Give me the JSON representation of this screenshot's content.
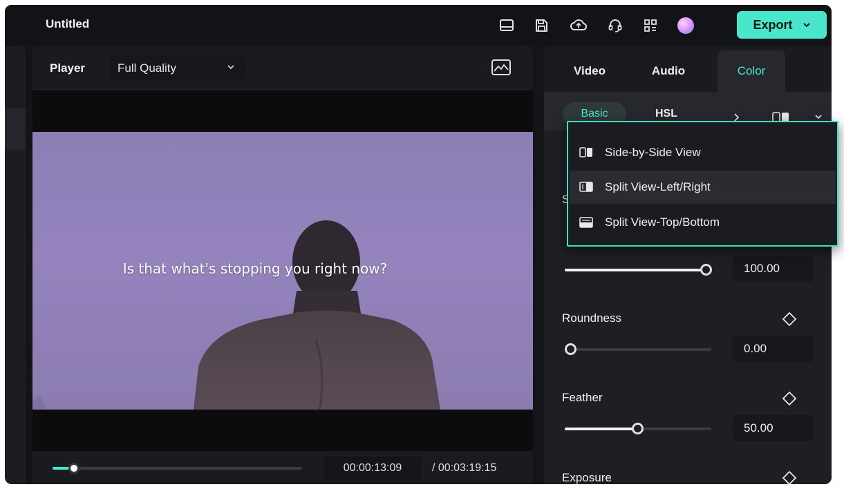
{
  "titlebar": {
    "title": "Untitled",
    "icons": [
      "layout-icon",
      "save-icon",
      "cloud-upload-icon",
      "headset-icon",
      "grid-apps-icon",
      "avatar"
    ],
    "export_label": "Export",
    "accent_color": "#49e6cb"
  },
  "player": {
    "label": "Player",
    "quality": "Full Quality",
    "subtitle": "Is that what's stopping you right now?",
    "current_time": "00:00:13:09",
    "total_time": "/ 00:03:19:15",
    "progress": 0.07
  },
  "panel": {
    "tabs": [
      "Video",
      "Audio",
      "Color"
    ],
    "active_tab": "Color",
    "subtabs": [
      "Basic",
      "HSL"
    ],
    "active_subtab": "Basic"
  },
  "view_menu": {
    "items": [
      {
        "label": "Side-by-Side View",
        "icon": "side-by-side-icon"
      },
      {
        "label": "Split View-Left/Right",
        "icon": "split-left-right-icon"
      },
      {
        "label": "Split View-Top/Bottom",
        "icon": "split-top-bottom-icon"
      }
    ]
  },
  "params": {
    "partial_label": "S",
    "first_value": "100.00",
    "first_level": 1.0,
    "roundness": {
      "label": "Roundness",
      "value": "0.00",
      "level": 0.0
    },
    "feather": {
      "label": "Feather",
      "value": "50.00",
      "level": 0.5
    },
    "exposure": {
      "label": "Exposure"
    }
  }
}
